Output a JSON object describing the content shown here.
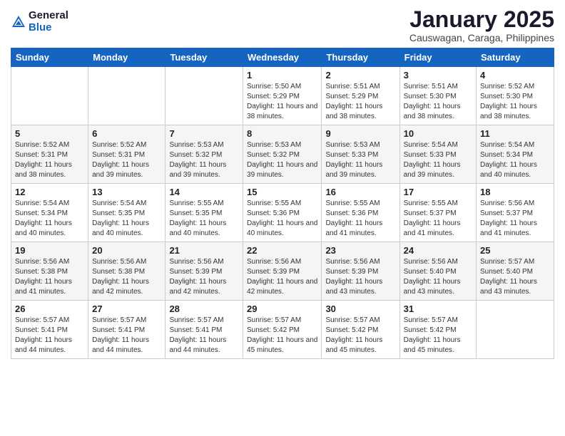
{
  "logo": {
    "general": "General",
    "blue": "Blue"
  },
  "header": {
    "month": "January 2025",
    "location": "Causwagan, Caraga, Philippines"
  },
  "weekdays": [
    "Sunday",
    "Monday",
    "Tuesday",
    "Wednesday",
    "Thursday",
    "Friday",
    "Saturday"
  ],
  "weeks": [
    [
      {
        "day": "",
        "sunrise": "",
        "sunset": "",
        "daylight": ""
      },
      {
        "day": "",
        "sunrise": "",
        "sunset": "",
        "daylight": ""
      },
      {
        "day": "",
        "sunrise": "",
        "sunset": "",
        "daylight": ""
      },
      {
        "day": "1",
        "sunrise": "Sunrise: 5:50 AM",
        "sunset": "Sunset: 5:29 PM",
        "daylight": "Daylight: 11 hours and 38 minutes."
      },
      {
        "day": "2",
        "sunrise": "Sunrise: 5:51 AM",
        "sunset": "Sunset: 5:29 PM",
        "daylight": "Daylight: 11 hours and 38 minutes."
      },
      {
        "day": "3",
        "sunrise": "Sunrise: 5:51 AM",
        "sunset": "Sunset: 5:30 PM",
        "daylight": "Daylight: 11 hours and 38 minutes."
      },
      {
        "day": "4",
        "sunrise": "Sunrise: 5:52 AM",
        "sunset": "Sunset: 5:30 PM",
        "daylight": "Daylight: 11 hours and 38 minutes."
      }
    ],
    [
      {
        "day": "5",
        "sunrise": "Sunrise: 5:52 AM",
        "sunset": "Sunset: 5:31 PM",
        "daylight": "Daylight: 11 hours and 38 minutes."
      },
      {
        "day": "6",
        "sunrise": "Sunrise: 5:52 AM",
        "sunset": "Sunset: 5:31 PM",
        "daylight": "Daylight: 11 hours and 39 minutes."
      },
      {
        "day": "7",
        "sunrise": "Sunrise: 5:53 AM",
        "sunset": "Sunset: 5:32 PM",
        "daylight": "Daylight: 11 hours and 39 minutes."
      },
      {
        "day": "8",
        "sunrise": "Sunrise: 5:53 AM",
        "sunset": "Sunset: 5:32 PM",
        "daylight": "Daylight: 11 hours and 39 minutes."
      },
      {
        "day": "9",
        "sunrise": "Sunrise: 5:53 AM",
        "sunset": "Sunset: 5:33 PM",
        "daylight": "Daylight: 11 hours and 39 minutes."
      },
      {
        "day": "10",
        "sunrise": "Sunrise: 5:54 AM",
        "sunset": "Sunset: 5:33 PM",
        "daylight": "Daylight: 11 hours and 39 minutes."
      },
      {
        "day": "11",
        "sunrise": "Sunrise: 5:54 AM",
        "sunset": "Sunset: 5:34 PM",
        "daylight": "Daylight: 11 hours and 40 minutes."
      }
    ],
    [
      {
        "day": "12",
        "sunrise": "Sunrise: 5:54 AM",
        "sunset": "Sunset: 5:34 PM",
        "daylight": "Daylight: 11 hours and 40 minutes."
      },
      {
        "day": "13",
        "sunrise": "Sunrise: 5:54 AM",
        "sunset": "Sunset: 5:35 PM",
        "daylight": "Daylight: 11 hours and 40 minutes."
      },
      {
        "day": "14",
        "sunrise": "Sunrise: 5:55 AM",
        "sunset": "Sunset: 5:35 PM",
        "daylight": "Daylight: 11 hours and 40 minutes."
      },
      {
        "day": "15",
        "sunrise": "Sunrise: 5:55 AM",
        "sunset": "Sunset: 5:36 PM",
        "daylight": "Daylight: 11 hours and 40 minutes."
      },
      {
        "day": "16",
        "sunrise": "Sunrise: 5:55 AM",
        "sunset": "Sunset: 5:36 PM",
        "daylight": "Daylight: 11 hours and 41 minutes."
      },
      {
        "day": "17",
        "sunrise": "Sunrise: 5:55 AM",
        "sunset": "Sunset: 5:37 PM",
        "daylight": "Daylight: 11 hours and 41 minutes."
      },
      {
        "day": "18",
        "sunrise": "Sunrise: 5:56 AM",
        "sunset": "Sunset: 5:37 PM",
        "daylight": "Daylight: 11 hours and 41 minutes."
      }
    ],
    [
      {
        "day": "19",
        "sunrise": "Sunrise: 5:56 AM",
        "sunset": "Sunset: 5:38 PM",
        "daylight": "Daylight: 11 hours and 41 minutes."
      },
      {
        "day": "20",
        "sunrise": "Sunrise: 5:56 AM",
        "sunset": "Sunset: 5:38 PM",
        "daylight": "Daylight: 11 hours and 42 minutes."
      },
      {
        "day": "21",
        "sunrise": "Sunrise: 5:56 AM",
        "sunset": "Sunset: 5:39 PM",
        "daylight": "Daylight: 11 hours and 42 minutes."
      },
      {
        "day": "22",
        "sunrise": "Sunrise: 5:56 AM",
        "sunset": "Sunset: 5:39 PM",
        "daylight": "Daylight: 11 hours and 42 minutes."
      },
      {
        "day": "23",
        "sunrise": "Sunrise: 5:56 AM",
        "sunset": "Sunset: 5:39 PM",
        "daylight": "Daylight: 11 hours and 43 minutes."
      },
      {
        "day": "24",
        "sunrise": "Sunrise: 5:56 AM",
        "sunset": "Sunset: 5:40 PM",
        "daylight": "Daylight: 11 hours and 43 minutes."
      },
      {
        "day": "25",
        "sunrise": "Sunrise: 5:57 AM",
        "sunset": "Sunset: 5:40 PM",
        "daylight": "Daylight: 11 hours and 43 minutes."
      }
    ],
    [
      {
        "day": "26",
        "sunrise": "Sunrise: 5:57 AM",
        "sunset": "Sunset: 5:41 PM",
        "daylight": "Daylight: 11 hours and 44 minutes."
      },
      {
        "day": "27",
        "sunrise": "Sunrise: 5:57 AM",
        "sunset": "Sunset: 5:41 PM",
        "daylight": "Daylight: 11 hours and 44 minutes."
      },
      {
        "day": "28",
        "sunrise": "Sunrise: 5:57 AM",
        "sunset": "Sunset: 5:41 PM",
        "daylight": "Daylight: 11 hours and 44 minutes."
      },
      {
        "day": "29",
        "sunrise": "Sunrise: 5:57 AM",
        "sunset": "Sunset: 5:42 PM",
        "daylight": "Daylight: 11 hours and 45 minutes."
      },
      {
        "day": "30",
        "sunrise": "Sunrise: 5:57 AM",
        "sunset": "Sunset: 5:42 PM",
        "daylight": "Daylight: 11 hours and 45 minutes."
      },
      {
        "day": "31",
        "sunrise": "Sunrise: 5:57 AM",
        "sunset": "Sunset: 5:42 PM",
        "daylight": "Daylight: 11 hours and 45 minutes."
      },
      {
        "day": "",
        "sunrise": "",
        "sunset": "",
        "daylight": ""
      }
    ]
  ]
}
